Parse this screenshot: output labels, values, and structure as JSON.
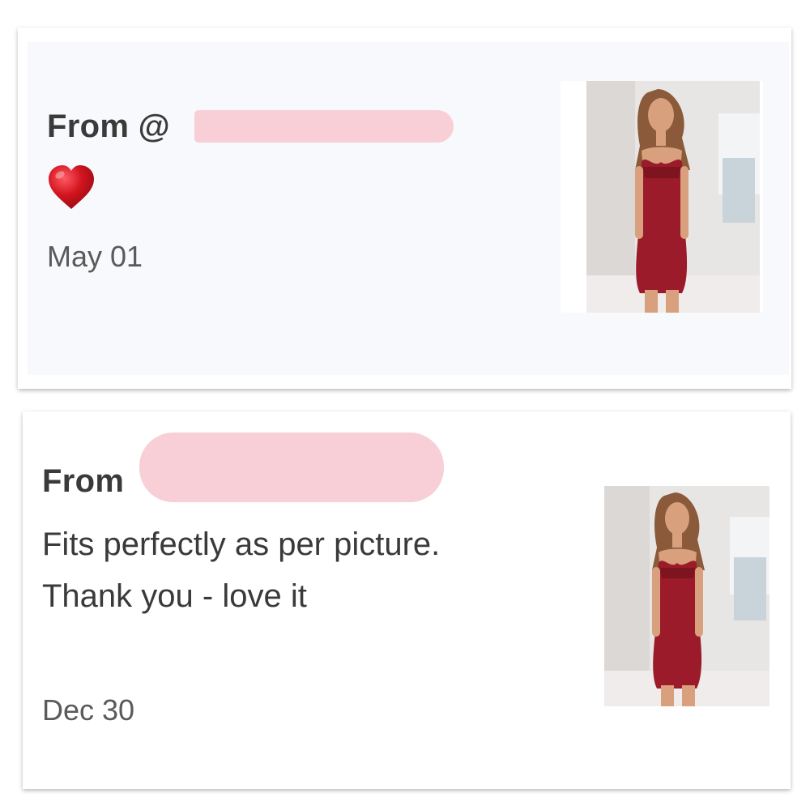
{
  "notifications": [
    {
      "from_label": "From @",
      "reaction": "heart-emoji",
      "date": "May 01",
      "thumbnail": "red-slip-dress-product-photo"
    },
    {
      "from_label": "From",
      "message": "Fits perfectly as per picture. Thank you - love it",
      "date": "Dec 30",
      "thumbnail": "red-slip-dress-product-photo"
    }
  ],
  "colors": {
    "heart": "#d2141f",
    "redaction": "#f8cfd6",
    "dress": "#9b1b2a",
    "card_tint": "#f8f9fc",
    "text": "#3a3a3a",
    "date_text": "#5a5a5a"
  }
}
